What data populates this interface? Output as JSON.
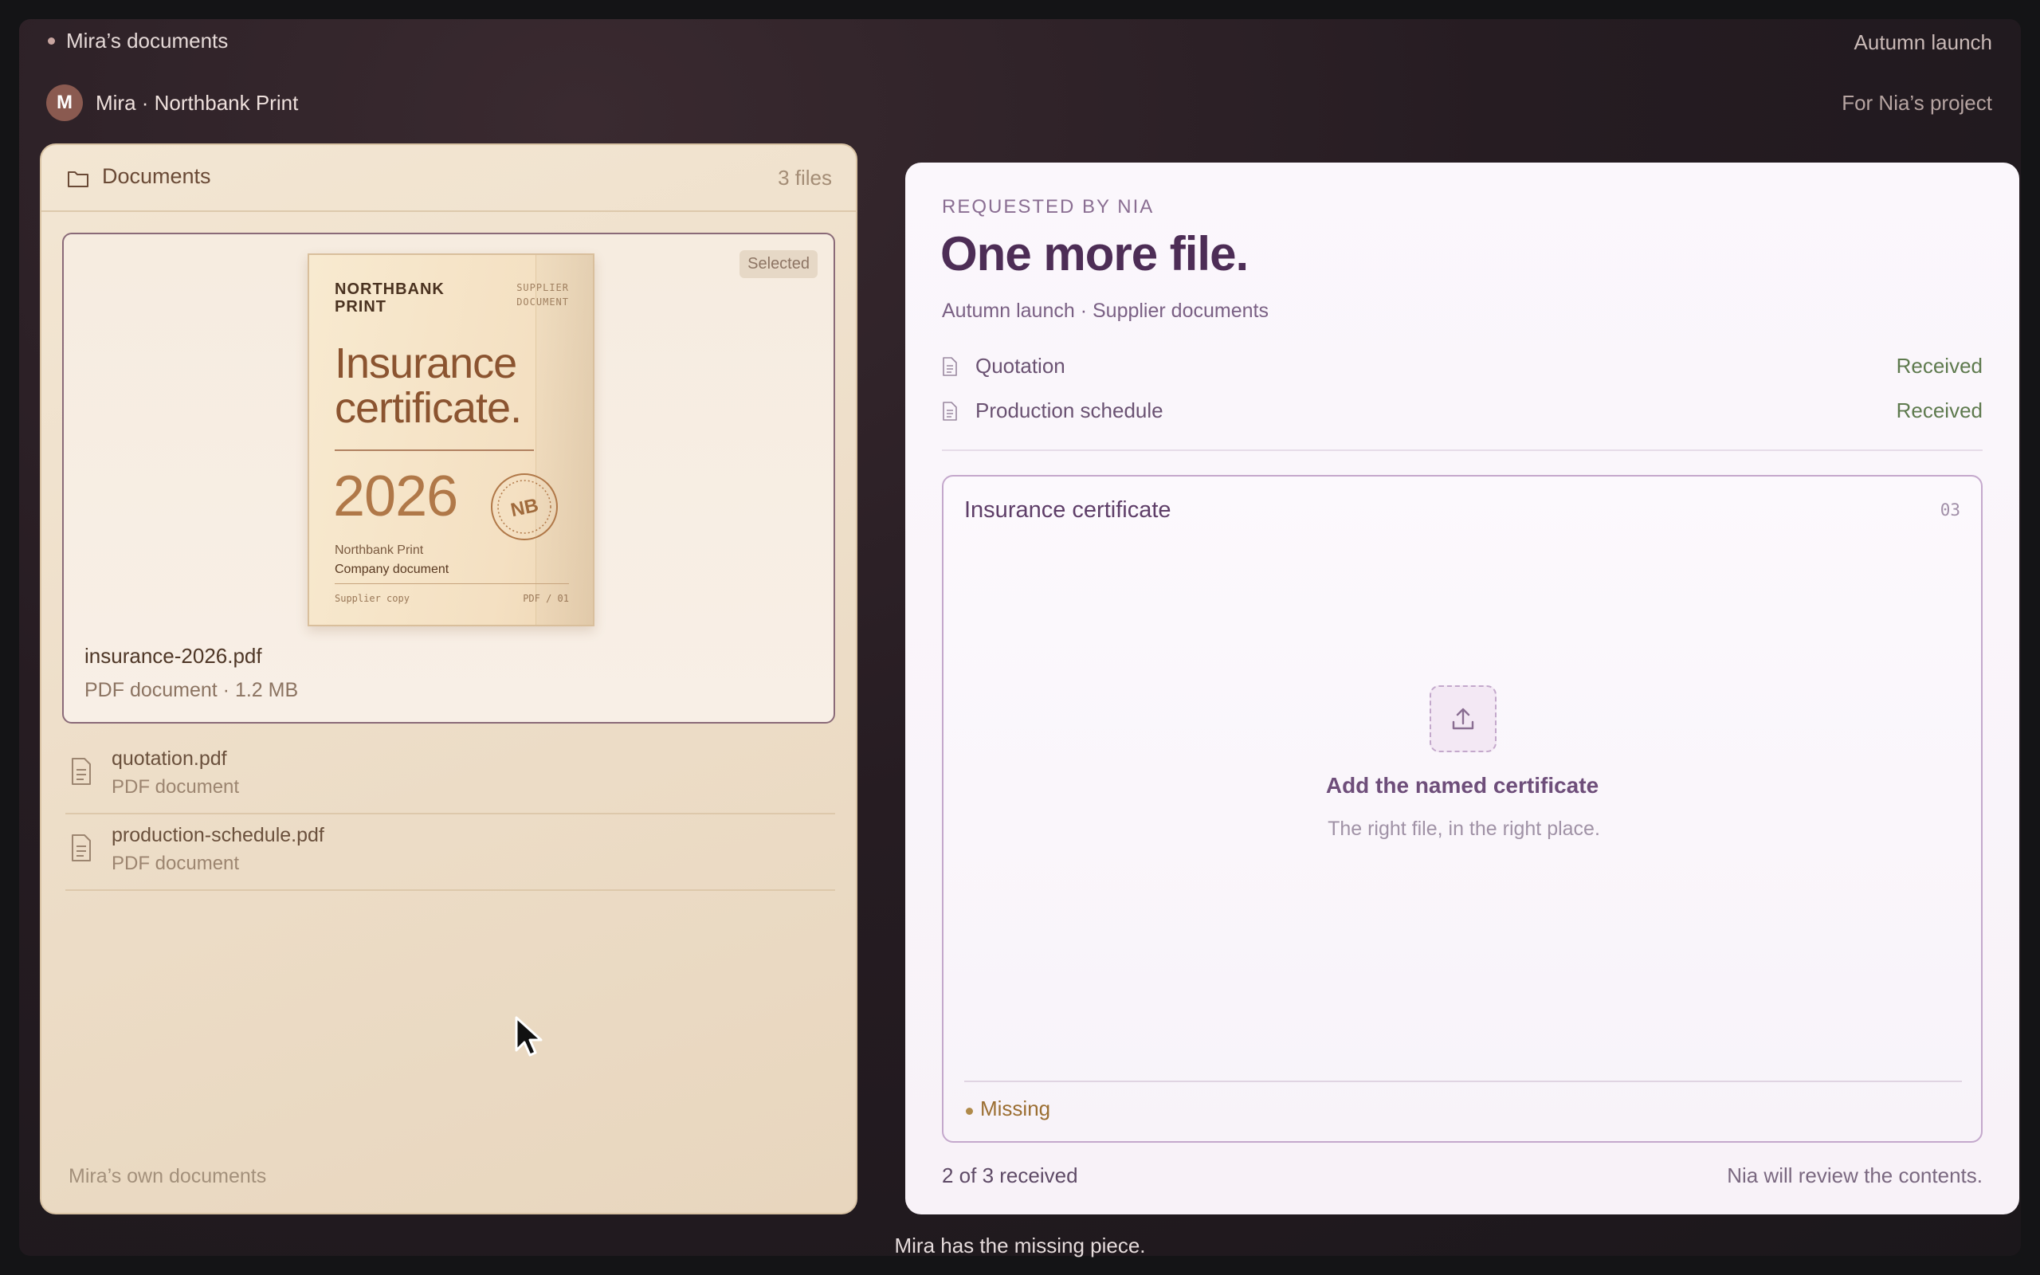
{
  "topbar": {
    "breadcrumb": "Mira’s documents",
    "campaign": "Autumn launch"
  },
  "account": {
    "avatar_initial": "M",
    "label": "Mira · Northbank Print",
    "project": "For Nia’s project"
  },
  "documents_panel": {
    "title": "Documents",
    "count": "3 files",
    "selected": {
      "badge": "Selected",
      "filename": "insurance-2026.pdf",
      "meta": "PDF document · 1.2 MB",
      "preview": {
        "brand": "NORTHBANK PRINT",
        "tag": "SUPPLIER DOCUMENT",
        "title": "Insurance certificate.",
        "year": "2026",
        "seal": "NB",
        "company": "Northbank Print",
        "doc_type": "Company document",
        "copy": "Supplier copy",
        "page": "PDF / 01"
      }
    },
    "files": [
      {
        "name": "quotation.pdf",
        "meta": "PDF document"
      },
      {
        "name": "production-schedule.pdf",
        "meta": "PDF document"
      }
    ],
    "footer": "Mira’s own documents"
  },
  "request_panel": {
    "eyebrow": "REQUESTED BY NIA",
    "title": "One more file.",
    "subtitle": "Autumn launch · Supplier documents",
    "items": [
      {
        "name": "Quotation",
        "status": "Received"
      },
      {
        "name": "Production schedule",
        "status": "Received"
      }
    ],
    "slot": {
      "title": "Insurance certificate",
      "number": "03",
      "upload_title": "Add the named certificate",
      "upload_sub": "The right file, in the right place.",
      "status": "Missing"
    },
    "progress": "2 of 3 received",
    "review_note": "Nia will review the contents."
  },
  "caption": "Mira has the missing piece.",
  "colors": {
    "received": "#5e7a4e",
    "missing": "#9b6e32",
    "accent": "#4d2d56"
  }
}
